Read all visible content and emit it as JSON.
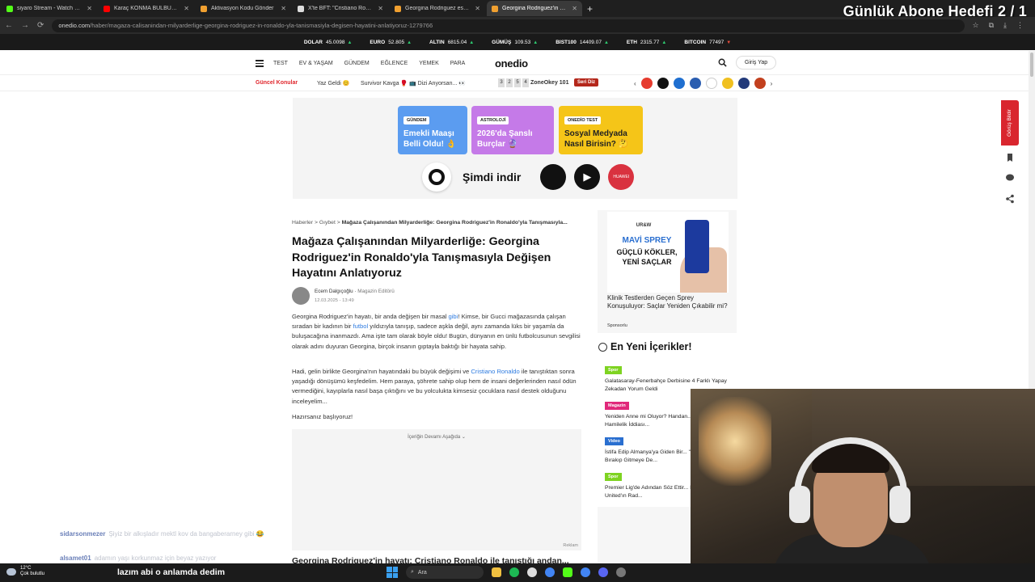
{
  "browser": {
    "tabs": [
      {
        "title": "siyaro Stream - Watch Live on K",
        "color": "#53fc18"
      },
      {
        "title": "Karaç KONMA BÜLBÜL KONMA",
        "color": "#ff0000"
      },
      {
        "title": "Aktivasyon Kodu Gönder",
        "color": "#f0a030"
      },
      {
        "title": "X'te BFT: \"Cristiano Ronaldo'nu",
        "color": "#dddddd"
      },
      {
        "title": "Georgina Rodriguez eski işi - Gi",
        "color": "#f0a030"
      },
      {
        "title": "Georgina Rodriguez'in Ronaldo",
        "color": "#f0a030"
      }
    ],
    "url_domain": "onedio.com",
    "url_path": "/haber/magaza-calisanindan-milyarderlige-georgina-rodriguez-in-ronaldo-yla-tanismasiyla-degisen-hayatini-anlatiyoruz-1279766"
  },
  "stream_overlay": {
    "goal": "Günlük Abone Hedefi 2 / 1"
  },
  "ticker": [
    {
      "name": "DOLAR",
      "value": "45.0098",
      "dir": "up"
    },
    {
      "name": "EURO",
      "value": "52.805",
      "dir": "up"
    },
    {
      "name": "ALTIN",
      "value": "6815.04",
      "dir": "up"
    },
    {
      "name": "GÜMÜŞ",
      "value": "109.53",
      "dir": "up"
    },
    {
      "name": "BIST100",
      "value": "14409.07",
      "dir": "up"
    },
    {
      "name": "ETH",
      "value": "2315.77",
      "dir": "up"
    },
    {
      "name": "BITCOIN",
      "value": "77497",
      "dir": "down"
    }
  ],
  "header": {
    "menu": [
      "TEST",
      "EV & YAŞAM",
      "GÜNDEM",
      "EĞLENCE",
      "YEMEK",
      "PARA"
    ],
    "logo": "onedio",
    "login": "Giriş Yap"
  },
  "topics": {
    "label": "Güncel Konular",
    "items": [
      "Yaz Geldi 😊",
      "Survivor Kavga 🥊",
      "📺 Dizi Anyorsan... 👀"
    ],
    "zone_digits": [
      "3",
      "2",
      "5",
      "4"
    ],
    "zone_label": "ZoneOkey 101",
    "seri": "Seri Diz"
  },
  "promo": {
    "cards": [
      {
        "tag": "GÜNDEM",
        "text": "Emekli Maaşı Belli Oldu! 👌",
        "bg": "#5b9cf0",
        "fg": "#ffffff"
      },
      {
        "tag": "ASTROLOJİ",
        "text": "2026'da Şanslı Burçlar 🔮",
        "bg": "#c57ae8",
        "fg": "#ffffff"
      },
      {
        "tag": "ONEDİO TEST",
        "text": "Sosyal Medyada Nasıl Birisin? 🤔",
        "bg": "#f5c518",
        "fg": "#222222"
      }
    ],
    "download": "Şimdi indir",
    "huawei": "HUAWEI"
  },
  "article": {
    "breadcrumb": [
      "Haberler",
      "Gıybet"
    ],
    "breadcrumb_current": "Mağaza Çalışanından Milyarderliğe: Georgina Rodriguez'in Ronaldo'yla Tanışmasıyla...",
    "title": "Mağaza Çalışanından Milyarderliğe: Georgina Rodriguez'in Ronaldo'yla Tanışmasıyla Değişen Hayatını Anlatıyoruz",
    "author": "Ecem Dalgıçoğlu",
    "author_role": "Magazin Editörü",
    "date": "12.03.2025 - 13:49",
    "p1": [
      "Georgina Rodriguez'in hayatı, bir anda değişen bir masal ",
      "gibi",
      "! Kimse, bir Gucci mağazasında çalışan sıradan bir kadının bir ",
      "futbol",
      " yıldızıyla tanışıp, sadece aşkla değil, aynı zamanda lüks bir yaşamla da buluşacağına inanmazdı. Ama işte tam olarak böyle oldu! Bugün, dünyanın en ünlü futbolcusunun sevgilisi olarak adını duyuran Georgina, birçok insanın gıptayla baktığı bir hayata sahip."
    ],
    "p2": [
      "Hadi, gelin birlikte Georgina'nın hayatındaki bu büyük değişimi ve ",
      "Cristiano Ronaldo",
      " ile tanıştıktan sonra yaşadığı dönüşümü keşfedelim. Hem paraya, şöhrete sahip olup hem de insani değerlerinden nasıl ödün vermediğini, kayıplarla nasıl başa çıktığını ve bu yolculukta kimsesiz çocuklara nasıl destek olduğunu inceleyelim..."
    ],
    "p3": "Hazırsanız başlıyoruz!",
    "continue": "İçeriğin Devamı Aşağıda ⌄",
    "ad_label": "Reklam",
    "next_heading": "Georgina Rodriguez'in hayatı: Cristiano Ronaldo ile tanıştığı andan..."
  },
  "sidebar": {
    "ad": {
      "brand": "UR&W",
      "line1": "MAVİ SPREY",
      "line2": "GÜÇLÜ KÖKLER, YENİ SAÇLAR",
      "title": "Klinik Testlerden Geçen Sprey Konuşuluyor: Saçlar Yeniden Çıkabilir mi?",
      "sponsored": "Sponsorlu"
    },
    "newest_title": "En Yeni İçerikler!",
    "newest": [
      {
        "badge": "Spor",
        "color": "#7ed321",
        "text": "Galatasaray-Fenerbahçe Derbisine 4 Farklı Yapay Zekadan Yorum Geldi"
      },
      {
        "badge": "Magazin",
        "color": "#e0287a",
        "text": "Yeniden Anne mi Oluyor? Handan... Gamze Erçel'in Hamilelik İddiası..."
      },
      {
        "badge": "Video",
        "color": "#2a6fd0",
        "text": "İstifa Edip Almanya'ya Giden Bir... \"Memurluğu Bırakıp Gitmeye De..."
      },
      {
        "badge": "Spor",
        "color": "#7ed321",
        "text": "Premier Lig'de Adından Söz Ettir... Ferdi, Manchester United'ın Rad..."
      }
    ]
  },
  "right_tools": {
    "feedback": "Görüş Bildir"
  },
  "chat": [
    {
      "user": "sidarsonmezer",
      "msg": "Şiyiz bir alkışladır mektl kov da bangaberarney gibi 😂"
    },
    {
      "user": "alsamet01",
      "msg": "adamın yaşı korkunmaz için beyaz yazıyor"
    }
  ],
  "caption": "lazım abi o anlamda dedim",
  "taskbar": {
    "weather_temp": "12°C",
    "weather_desc": "Çok bulutlu",
    "search": "Ara"
  }
}
